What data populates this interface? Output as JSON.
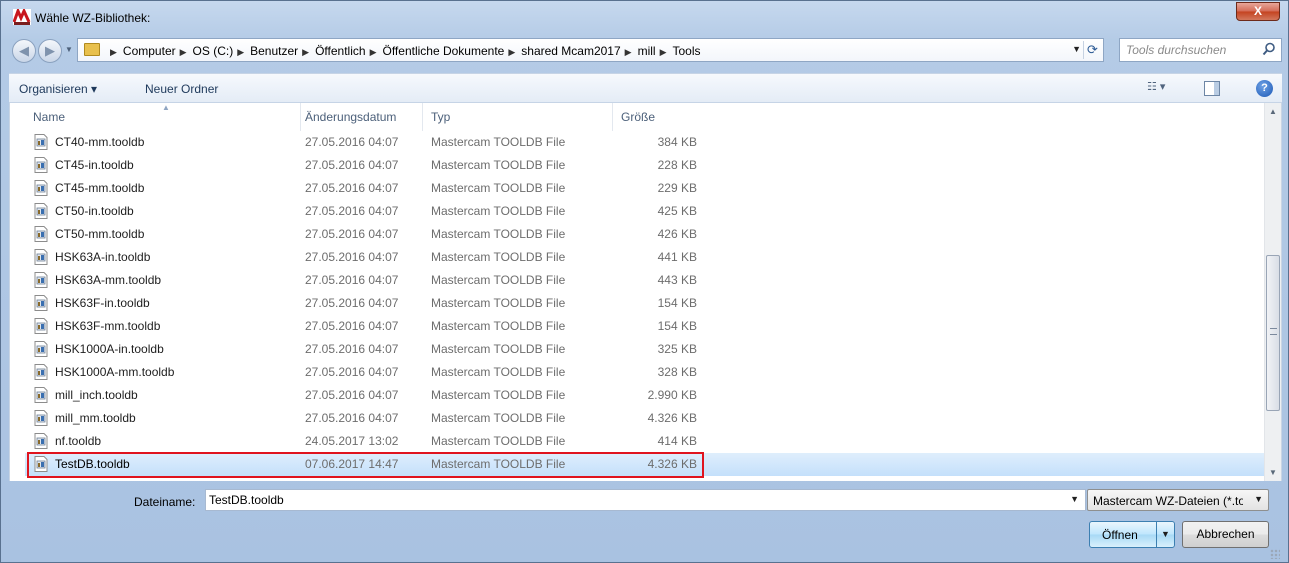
{
  "window": {
    "title": "Wähle WZ-Bibliothek:",
    "app_icon": "mastercam-icon",
    "close_label": "X"
  },
  "address": {
    "breadcrumbs": [
      "Computer",
      "OS (C:)",
      "Benutzer",
      "Öffentlich",
      "Öffentliche Dokumente",
      "shared Mcam2017",
      "mill",
      "Tools"
    ],
    "search_placeholder": "Tools durchsuchen"
  },
  "toolbar": {
    "organize_label": "Organisieren ▾",
    "new_folder_label": "Neuer Ordner"
  },
  "columns": {
    "name": "Name",
    "date": "Änderungsdatum",
    "type": "Typ",
    "size": "Größe"
  },
  "files": [
    {
      "name": "CT40-mm.tooldb",
      "date": "27.05.2016 04:07",
      "type": "Mastercam TOOLDB File",
      "size": "384 KB",
      "selected": false
    },
    {
      "name": "CT45-in.tooldb",
      "date": "27.05.2016 04:07",
      "type": "Mastercam TOOLDB File",
      "size": "228 KB",
      "selected": false
    },
    {
      "name": "CT45-mm.tooldb",
      "date": "27.05.2016 04:07",
      "type": "Mastercam TOOLDB File",
      "size": "229 KB",
      "selected": false
    },
    {
      "name": "CT50-in.tooldb",
      "date": "27.05.2016 04:07",
      "type": "Mastercam TOOLDB File",
      "size": "425 KB",
      "selected": false
    },
    {
      "name": "CT50-mm.tooldb",
      "date": "27.05.2016 04:07",
      "type": "Mastercam TOOLDB File",
      "size": "426 KB",
      "selected": false
    },
    {
      "name": "HSK63A-in.tooldb",
      "date": "27.05.2016 04:07",
      "type": "Mastercam TOOLDB File",
      "size": "441 KB",
      "selected": false
    },
    {
      "name": "HSK63A-mm.tooldb",
      "date": "27.05.2016 04:07",
      "type": "Mastercam TOOLDB File",
      "size": "443 KB",
      "selected": false
    },
    {
      "name": "HSK63F-in.tooldb",
      "date": "27.05.2016 04:07",
      "type": "Mastercam TOOLDB File",
      "size": "154 KB",
      "selected": false
    },
    {
      "name": "HSK63F-mm.tooldb",
      "date": "27.05.2016 04:07",
      "type": "Mastercam TOOLDB File",
      "size": "154 KB",
      "selected": false
    },
    {
      "name": "HSK1000A-in.tooldb",
      "date": "27.05.2016 04:07",
      "type": "Mastercam TOOLDB File",
      "size": "325 KB",
      "selected": false
    },
    {
      "name": "HSK1000A-mm.tooldb",
      "date": "27.05.2016 04:07",
      "type": "Mastercam TOOLDB File",
      "size": "328 KB",
      "selected": false
    },
    {
      "name": "mill_inch.tooldb",
      "date": "27.05.2016 04:07",
      "type": "Mastercam TOOLDB File",
      "size": "2.990 KB",
      "selected": false
    },
    {
      "name": "mill_mm.tooldb",
      "date": "27.05.2016 04:07",
      "type": "Mastercam TOOLDB File",
      "size": "4.326 KB",
      "selected": false
    },
    {
      "name": "nf.tooldb",
      "date": "24.05.2017 13:02",
      "type": "Mastercam TOOLDB File",
      "size": "414 KB",
      "selected": false
    },
    {
      "name": "TestDB.tooldb",
      "date": "07.06.2017 14:47",
      "type": "Mastercam TOOLDB File",
      "size": "4.326 KB",
      "selected": true
    }
  ],
  "footer": {
    "filename_label": "Dateiname:",
    "filename_value": "TestDB.tooldb",
    "filter_label": "Mastercam WZ-Dateien (*.tooldb)",
    "open_label": "Öffnen",
    "cancel_label": "Abbrechen"
  },
  "colors": {
    "selection_outline": "#e0141e",
    "selection_fill": "#c4e0fb",
    "window_frame": "#b4cbe6"
  },
  "icons": {
    "file": "tooldb-file-icon",
    "search": "search-icon",
    "refresh": "refresh-icon",
    "help": "help-icon",
    "views": "views-icon",
    "preview_pane": "preview-pane-icon"
  }
}
